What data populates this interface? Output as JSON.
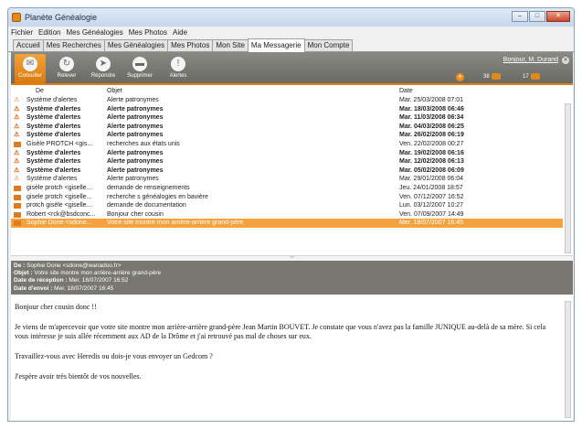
{
  "window": {
    "title": "Planète Généalogie"
  },
  "menu": [
    "Fichier",
    "Edition",
    "Mes Généalogies",
    "Mes Photos",
    "Aide"
  ],
  "tabs": [
    "Accueil",
    "Mes Recherches",
    "Mes Généalogies",
    "Mes Photos",
    "Mon Site",
    "Ma Messagerie",
    "Mon Compte"
  ],
  "toolbar": {
    "consulter": "Consulter",
    "relever": "Relever",
    "repondre": "Répondre",
    "supprimer": "Supprimer",
    "alertes": "Alertes",
    "user": "Bonjour, M. Durand",
    "count1": "38",
    "count2": "17"
  },
  "columns": {
    "from": "De",
    "subject": "Objet",
    "date": "Date"
  },
  "messages": [
    {
      "icon": "warn",
      "from": "Système d'alertes",
      "subject": "Alerte patronymes",
      "date": "Mar. 25/03/2008 07:01",
      "unread": false
    },
    {
      "icon": "warn",
      "from": "Système d'alertes",
      "subject": "Alerte patronymes",
      "date": "Mar. 18/03/2008 06:46",
      "unread": true
    },
    {
      "icon": "warn",
      "from": "Système d'alertes",
      "subject": "Alerte patronymes",
      "date": "Mar. 11/03/2008 06:34",
      "unread": true
    },
    {
      "icon": "warn",
      "from": "Système d'alertes",
      "subject": "Alerte patronymes",
      "date": "Mar. 04/03/2008 06:25",
      "unread": true
    },
    {
      "icon": "warn",
      "from": "Système d'alertes",
      "subject": "Alerte patronymes",
      "date": "Mar. 26/02/2008 06:19",
      "unread": true
    },
    {
      "icon": "mail",
      "from": "Gisèle PROTCH <gis...",
      "subject": "recherches aux états unis",
      "date": "Ven. 22/02/2008 00:27",
      "unread": false
    },
    {
      "icon": "warn",
      "from": "Système d'alertes",
      "subject": "Alerte patronymes",
      "date": "Mar. 19/02/2008 06:16",
      "unread": true
    },
    {
      "icon": "warn",
      "from": "Système d'alertes",
      "subject": "Alerte patronymes",
      "date": "Mar. 12/02/2008 06:13",
      "unread": true
    },
    {
      "icon": "warn",
      "from": "Système d'alertes",
      "subject": "Alerte patronymes",
      "date": "Mar. 05/02/2008 06:09",
      "unread": true
    },
    {
      "icon": "warn",
      "from": "Système d'alertes",
      "subject": "Alerte patronymes",
      "date": "Mar. 29/01/2008 06:04",
      "unread": false
    },
    {
      "icon": "mail",
      "from": "gisèle protch <giselle...",
      "subject": "demande de renseignements",
      "date": "Jeu. 24/01/2008 18:57",
      "unread": false
    },
    {
      "icon": "mail",
      "from": "gisele protch <giselle...",
      "subject": "recherche s généalogies en bavière",
      "date": "Ven. 07/12/2007 16:52",
      "unread": false
    },
    {
      "icon": "mail",
      "from": "protch gisèle <giselle...",
      "subject": "demande de documentation",
      "date": "Lun. 03/12/2007 10:27",
      "unread": false
    },
    {
      "icon": "mail",
      "from": "Robert <rck@bsdconc...",
      "subject": "Bonjour cher cousin",
      "date": "Ven. 07/09/2007 14:49",
      "unread": false
    },
    {
      "icon": "mail",
      "from": "Sophie Done <sdone...",
      "subject": "Votre site montre mon arrière-arrière grand-père",
      "date": "Mer. 18/07/2007 16:45",
      "unread": false,
      "selected": true
    }
  ],
  "message_header": {
    "de_label": "De :",
    "de_value": " Sophie Done <sdone@wanadoo.fr>",
    "objet_label": "Objet :",
    "objet_value": " Votre site montre mon arrière-arrière grand-père",
    "reception_label": "Date de réception :",
    "reception_value": " Mer. 18/07/2007 16:52",
    "envoi_label": "Date d'envoi :",
    "envoi_value": " Mer. 18/07/2007 16:45"
  },
  "message_body": [
    "Bonjour cher cousin donc !!",
    "Je viens de m'apercevoir que votre site montre mon arrière-arrière grand-père Jean Martin BOUVET. Je constate que vous n'avez pas la famille JUNIQUE au-delà de sa mère. Si cela vous intéresse je suis allée récemment aux AD de la Drôme et j'ai retrouvé pas mal de choses sur eux.",
    "Travaillez-vous avec Heredis ou dois-je vous envoyer un Gedcom ?",
    "J'espère avoir très bientôt de vos nouvelles."
  ]
}
